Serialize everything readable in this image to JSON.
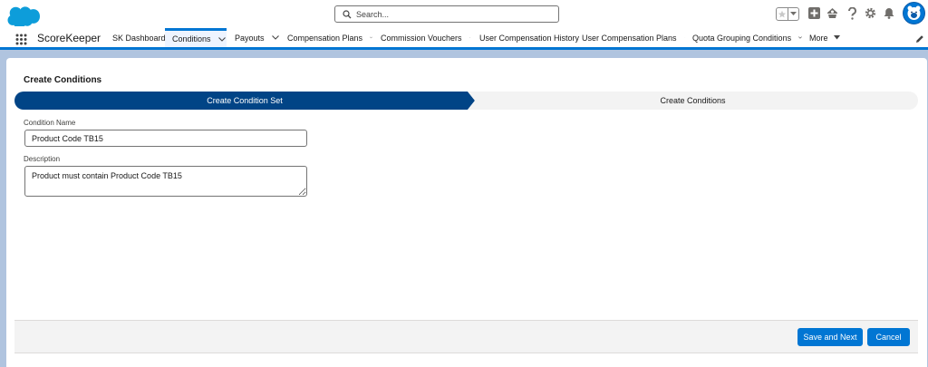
{
  "header": {
    "search_placeholder": "Search...",
    "icons": [
      "salesforce-logo",
      "star-icon",
      "chevron-down-icon",
      "add-icon",
      "trailhead-icon",
      "help-icon",
      "gear-icon",
      "bell-icon",
      "avatar"
    ]
  },
  "nav": {
    "app_name": "ScoreKeeper",
    "items": [
      {
        "label": "SK Dashboard",
        "has_menu": false,
        "active": false
      },
      {
        "label": "Conditions",
        "has_menu": true,
        "active": true
      },
      {
        "label": "Payouts",
        "has_menu": true,
        "active": false
      },
      {
        "label": "Compensation Plans",
        "has_menu": true,
        "active": false
      },
      {
        "label": "Commission Vouchers",
        "has_menu": true,
        "active": false
      },
      {
        "label": "User Compensation History",
        "has_menu": false,
        "active": false
      },
      {
        "label": "User Compensation Plans",
        "has_menu": true,
        "active": false
      },
      {
        "label": "Quota Grouping Conditions",
        "has_menu": true,
        "active": false
      },
      {
        "label": "More",
        "has_menu": true,
        "active": false
      }
    ]
  },
  "card": {
    "title": "Create Conditions",
    "path": {
      "steps": [
        "Create Condition Set",
        "Create Conditions"
      ],
      "current_step": 0
    },
    "form": {
      "condition_name_label": "Condition Name",
      "condition_name_value": "Product Code TB15",
      "description_label": "Description",
      "description_value": "Product must contain Product Code TB15"
    },
    "footer": {
      "save_label": "Save and Next",
      "cancel_label": "Cancel"
    }
  },
  "colors": {
    "brand": "#0176d3",
    "path_active": "#014486",
    "background": "#b0c4df"
  }
}
